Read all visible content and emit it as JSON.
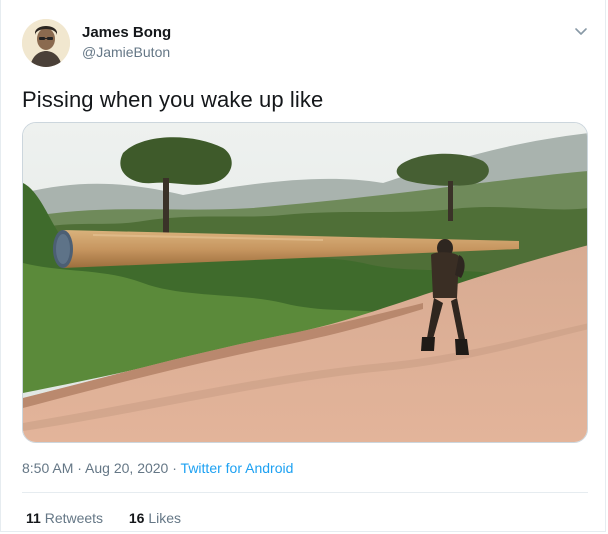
{
  "author": {
    "name": "James Bong",
    "handle": "@JamieButon",
    "avatar_icon": "avatar-icon"
  },
  "menu_icon": "chevron-down-icon",
  "tweet": {
    "text": "Pissing when you wake up like"
  },
  "media": {
    "icon": "photo-image"
  },
  "meta": {
    "time": "8:50 AM",
    "sep1": " · ",
    "date": "Aug 20, 2020",
    "sep2": " · ",
    "source": "Twitter for Android"
  },
  "stats": {
    "retweets_count": "11",
    "retweets_label": "Retweets",
    "likes_count": "16",
    "likes_label": "Likes"
  },
  "colors": {
    "link": "#1da1f2",
    "secondary_text": "#657786",
    "divider": "#e6ecf0"
  }
}
